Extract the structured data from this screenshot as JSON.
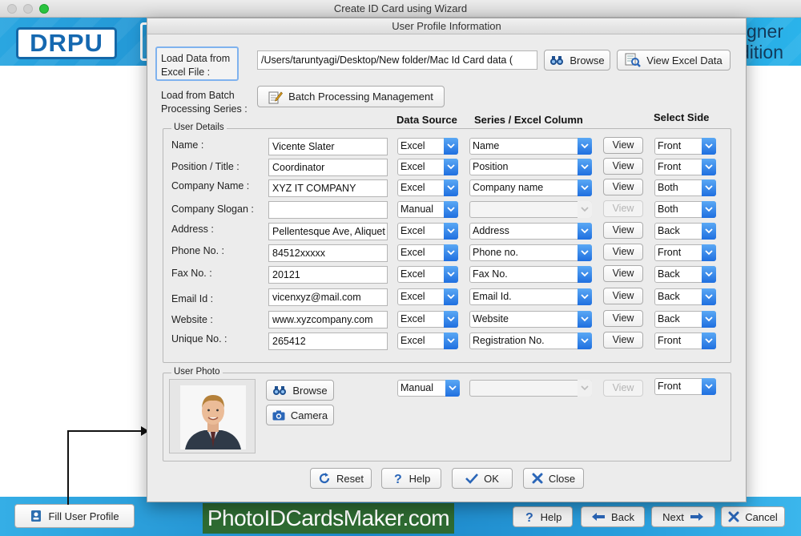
{
  "window": {
    "title": "Create ID Card using Wizard"
  },
  "brand": {
    "logo_text": "DRPU",
    "right_line1": "gner",
    "right_line2": "dition"
  },
  "dialog": {
    "title": "User Profile Information"
  },
  "excel": {
    "label": "Load Data from Excel File :",
    "path": "/Users/taruntyagi/Desktop/New folder/Mac Id Card data (",
    "browse_label": "Browse",
    "view_excel_label": "View Excel Data"
  },
  "batch": {
    "label": "Load from Batch Processing Series :",
    "button_label": "Batch Processing Management"
  },
  "headers": {
    "data_source": "Data Source",
    "series_column": "Series / Excel Column",
    "select_side": "Select Side"
  },
  "user_details": {
    "title": "User Details",
    "view_label": "View"
  },
  "rows": [
    {
      "label": "Name :",
      "value": "Vicente Slater",
      "source": "Excel",
      "column": "Name",
      "side": "Front",
      "view_enabled": true
    },
    {
      "label": "Position / Title :",
      "value": "Coordinator",
      "source": "Excel",
      "column": "Position",
      "side": "Front",
      "view_enabled": true
    },
    {
      "label": "Company Name :",
      "value": "XYZ IT COMPANY",
      "source": "Excel",
      "column": "Company name",
      "side": "Both",
      "view_enabled": true
    },
    {
      "label": "Company Slogan :",
      "value": "",
      "source": "Manual",
      "column": "",
      "side": "Both",
      "view_enabled": false
    },
    {
      "label": "Address :",
      "value": "Pellentesque Ave, Aliquet",
      "source": "Excel",
      "column": "Address",
      "side": "Back",
      "view_enabled": true
    },
    {
      "label": "Phone No. :",
      "value": "84512xxxxx",
      "source": "Excel",
      "column": "Phone no.",
      "side": "Front",
      "view_enabled": true
    },
    {
      "label": "Fax No. :",
      "value": "20121",
      "source": "Excel",
      "column": "Fax No.",
      "side": "Back",
      "view_enabled": true
    },
    {
      "label": "Email Id :",
      "value": "vicenxyz@mail.com",
      "source": "Excel",
      "column": "Email Id.",
      "side": "Back",
      "view_enabled": true
    },
    {
      "label": "Website :",
      "value": "www.xyzcompany.com",
      "source": "Excel",
      "column": "Website",
      "side": "Back",
      "view_enabled": true
    },
    {
      "label": "Unique No. :",
      "value": "265412",
      "source": "Excel",
      "column": "Registration No.",
      "side": "Front",
      "view_enabled": true
    }
  ],
  "user_photo": {
    "title": "User Photo",
    "browse_label": "Browse",
    "camera_label": "Camera",
    "source": "Manual",
    "column": "",
    "side": "Front",
    "view_label": "View"
  },
  "dialog_buttons": {
    "reset": "Reset",
    "help": "Help",
    "ok": "OK",
    "close": "Close"
  },
  "wizard": {
    "fill_profile": "Fill User Profile",
    "site": "PhotoIDCardsMaker.com",
    "help": "Help",
    "back": "Back",
    "next": "Next",
    "cancel": "Cancel"
  },
  "colors": {
    "accent_blue": "#1f6fe0",
    "banner_blue": "#1b86c9",
    "site_green": "#2e6b32"
  }
}
